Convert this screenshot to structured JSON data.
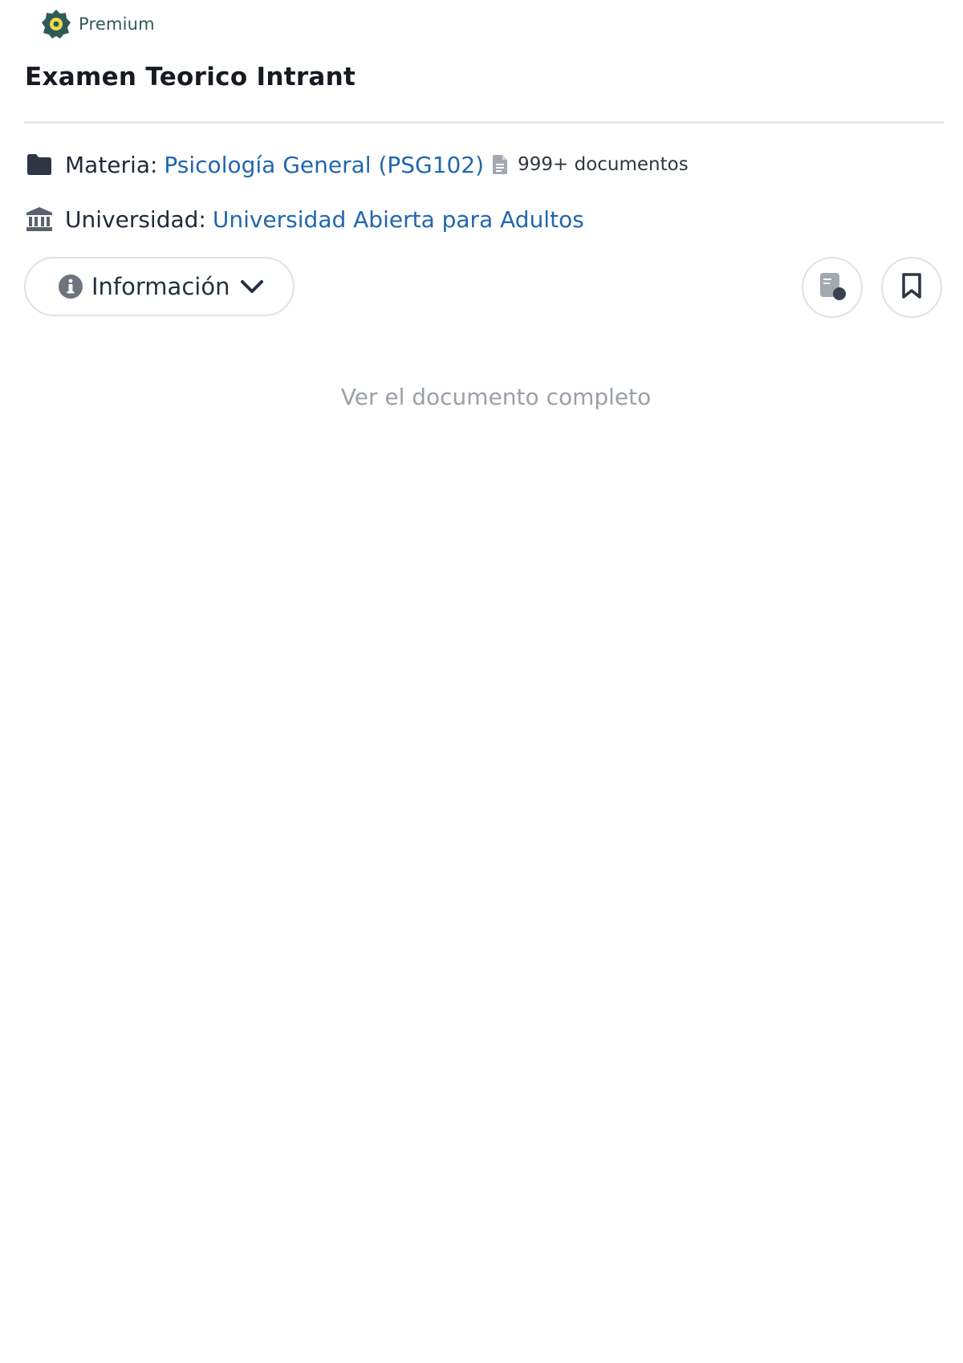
{
  "badge": {
    "label": "Premium",
    "icon": "premium-gear-icon",
    "color": "#2f5a57",
    "accent": "#f1d94b"
  },
  "document": {
    "title": "Examen Teorico Intrant"
  },
  "meta": {
    "subject": {
      "icon": "folder-icon",
      "key": "Materia:",
      "value": "Psicología General (PSG102)",
      "doc_count_icon": "file-icon",
      "doc_count": "999+ documentos"
    },
    "university": {
      "icon": "university-icon",
      "key": "Universidad:",
      "value": "Universidad Abierta para Adultos"
    }
  },
  "actions": {
    "info_label": "Información",
    "info_icon": "info-icon",
    "info_chevron": "chevron-down-icon",
    "notes_icon": "document-notes-icon",
    "save_icon": "bookmark-icon"
  },
  "preview": {
    "view_full_label": "Ver el documento completo"
  },
  "colors": {
    "link": "#2167ad",
    "muted": "#9aa0a8",
    "border": "#dde1e7",
    "icon": "#2d3644"
  }
}
